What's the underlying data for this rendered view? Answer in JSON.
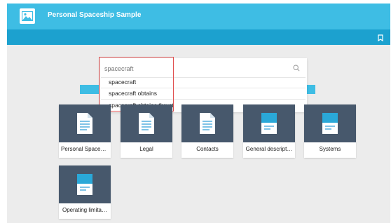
{
  "header": {
    "title": "Personal Spaceship Sample"
  },
  "toolbar": {
    "icons": [
      "bookmark-icon"
    ]
  },
  "search": {
    "value": "spacecraft",
    "suggestions": [
      "spacecraft",
      "spacecraft obtains",
      "spacecraft obtains thrust"
    ]
  },
  "tiles": [
    {
      "label": "Personal Spaces…",
      "icon": "document-icon"
    },
    {
      "label": "Legal",
      "icon": "document-icon"
    },
    {
      "label": "Contacts",
      "icon": "document-icon"
    },
    {
      "label": "General descript…",
      "icon": "book-icon"
    },
    {
      "label": "Systems",
      "icon": "book-icon"
    },
    {
      "label": "Operating limita…",
      "icon": "book-icon"
    }
  ],
  "colors": {
    "header": "#3ebde4",
    "toolbar": "#1ca1cf",
    "tile_thumb": "#47586c",
    "highlight": "#e05050"
  }
}
